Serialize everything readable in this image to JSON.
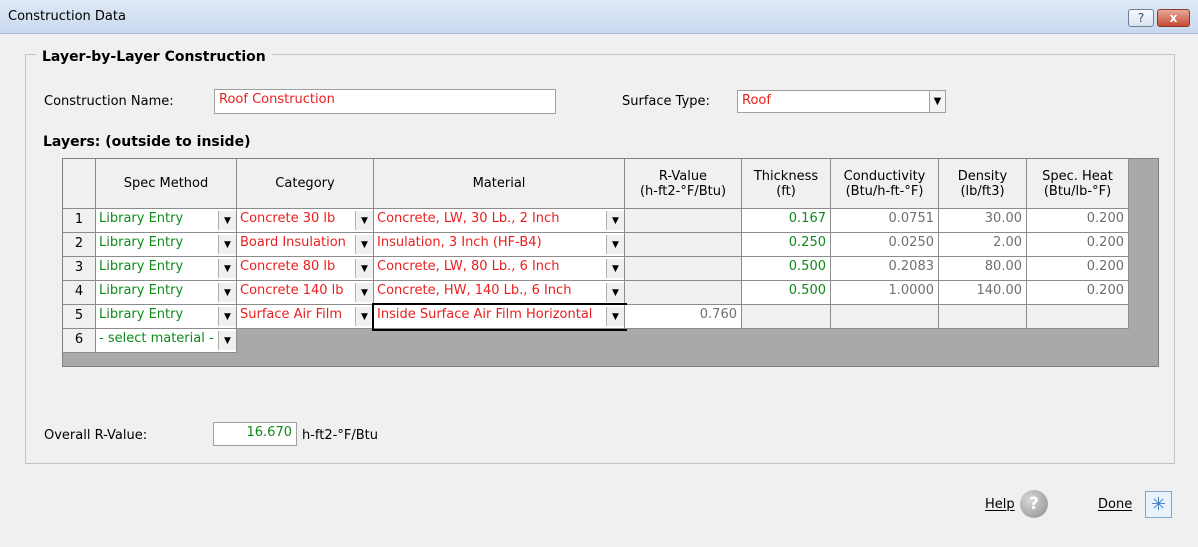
{
  "window": {
    "title": "Construction Data",
    "help_button": "?",
    "close_button": "x"
  },
  "group_title": "Layer-by-Layer Construction",
  "construction_name": {
    "label": "Construction Name:",
    "value": "Roof Construction"
  },
  "surface_type": {
    "label": "Surface Type:",
    "value": "Roof"
  },
  "layers_title": "Layers:   (outside to inside)",
  "columns": [
    {
      "label": "Spec Method"
    },
    {
      "label": "Category"
    },
    {
      "label": "Material"
    },
    {
      "label": "R-Value\n(h-ft2-°F/Btu)"
    },
    {
      "label": "Thickness\n(ft)"
    },
    {
      "label": "Conductivity\n(Btu/h-ft-°F)"
    },
    {
      "label": "Density\n(lb/ft3)"
    },
    {
      "label": "Spec. Heat\n(Btu/lb-°F)"
    }
  ],
  "rows": [
    {
      "num": "1",
      "spec": "Library Entry",
      "category": "Concrete 30 lb",
      "material": "Concrete, LW, 30 Lb., 2 Inch",
      "rvalue": "",
      "thickness": "0.167",
      "conductivity": "0.0751",
      "density": "30.00",
      "spec_heat": "0.200"
    },
    {
      "num": "2",
      "spec": "Library Entry",
      "category": "Board Insulation",
      "material": "Insulation, 3 Inch (HF-B4)",
      "rvalue": "",
      "thickness": "0.250",
      "conductivity": "0.0250",
      "density": "2.00",
      "spec_heat": "0.200"
    },
    {
      "num": "3",
      "spec": "Library Entry",
      "category": "Concrete 80 lb",
      "material": "Concrete, LW, 80 Lb., 6 Inch",
      "rvalue": "",
      "thickness": "0.500",
      "conductivity": "0.2083",
      "density": "80.00",
      "spec_heat": "0.200"
    },
    {
      "num": "4",
      "spec": "Library Entry",
      "category": "Concrete 140 lb",
      "material": "Concrete, HW, 140 Lb., 6 Inch",
      "rvalue": "",
      "thickness": "0.500",
      "conductivity": "1.0000",
      "density": "140.00",
      "spec_heat": "0.200"
    },
    {
      "num": "5",
      "spec": "Library Entry",
      "category": "Surface Air Film",
      "material": "Inside Surface Air Film Horizontal",
      "rvalue": "0.760",
      "thickness": "",
      "conductivity": "",
      "density": "",
      "spec_heat": ""
    },
    {
      "num": "6",
      "spec": "- select material -"
    }
  ],
  "overall": {
    "label": "Overall R-Value:",
    "value": "16.670",
    "units": "h-ft2-°F/Btu"
  },
  "buttons": {
    "help": "Help",
    "done": "Done"
  },
  "colors": {
    "library_text": "#0e8a1a",
    "category_text": "#e8201f",
    "readonly_text": "#707070"
  }
}
